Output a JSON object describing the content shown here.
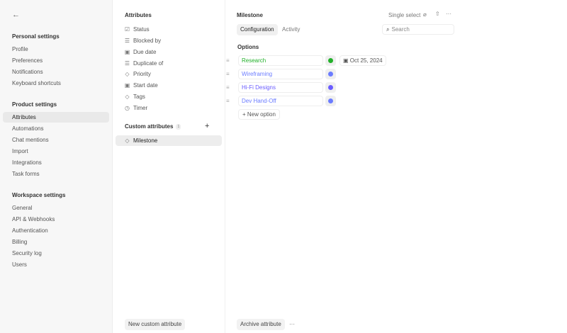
{
  "sidebar": {
    "personal_title": "Personal settings",
    "personal": [
      "Profile",
      "Preferences",
      "Notifications",
      "Keyboard shortcuts"
    ],
    "product_title": "Product settings",
    "product": [
      "Attributes",
      "Automations",
      "Chat mentions",
      "Import",
      "Integrations",
      "Task forms"
    ],
    "workspace_title": "Workspace settings",
    "workspace": [
      "General",
      "API & Webhooks",
      "Authentication",
      "Billing",
      "Security log",
      "Users"
    ]
  },
  "attributes": {
    "title": "Attributes",
    "items": [
      "Status",
      "Blocked by",
      "Due date",
      "Duplicate of",
      "Priority",
      "Start date",
      "Tags",
      "Timer"
    ],
    "custom_title": "Custom attributes",
    "custom_count": "1",
    "custom": [
      "Milestone"
    ],
    "new_button": "New custom attribute"
  },
  "detail": {
    "title": "Milestone",
    "type": "Single select",
    "tabs": [
      "Configuration",
      "Activity"
    ],
    "search_placeholder": "Search",
    "options_title": "Options",
    "options": [
      {
        "label": "Research",
        "color": "#22b02a"
      },
      {
        "label": "Wireframing",
        "color": "#6b7cff"
      },
      {
        "label": "Hi-Fi Designs",
        "color": "#6a5cff"
      },
      {
        "label": "Dev Hand-Off",
        "color": "#6b7cff"
      }
    ],
    "date": "Oct 25, 2024",
    "new_option": "New option",
    "archive": "Archive attribute"
  }
}
